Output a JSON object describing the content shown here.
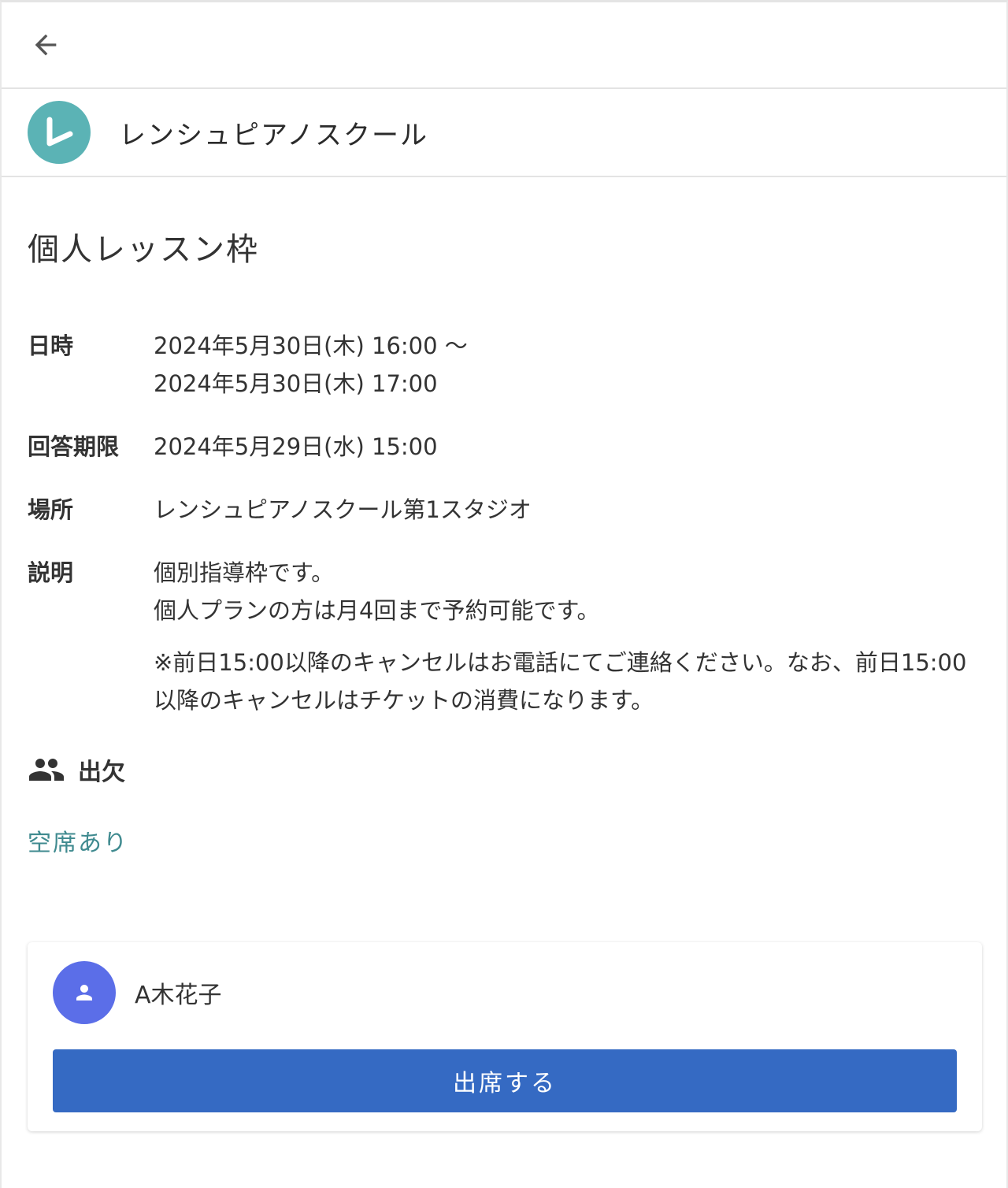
{
  "topbar": {
    "back_icon": "arrow-left-icon"
  },
  "organization": {
    "logo_letter": "L",
    "logo_color": "#5bb3b5",
    "name": "レンシュピアノスクール"
  },
  "event": {
    "title": "個人レッスン枠",
    "details": {
      "datetime": {
        "label": "日時",
        "start": "2024年5月30日(木) 16:00 〜",
        "end": "2024年5月30日(木) 17:00"
      },
      "deadline": {
        "label": "回答期限",
        "value": "2024年5月29日(水) 15:00"
      },
      "place": {
        "label": "場所",
        "value": "レンシュピアノスクール第1スタジオ"
      },
      "description": {
        "label": "説明",
        "line1": "個別指導枠です。",
        "line2": "個人プランの方は月4回まで予約可能です。",
        "note": "※前日15:00以降のキャンセルはお電話にてご連絡ください。なお、前日15:00以降のキャンセルはチケットの消費になります。"
      }
    }
  },
  "attendance": {
    "icon": "people-icon",
    "title": "出欠",
    "status": "空席あり",
    "status_color": "#3f8a8f"
  },
  "member": {
    "avatar_icon": "person-icon",
    "avatar_color": "#5b6ee8",
    "name": "A木花子",
    "attend_button_label": "出席する",
    "button_color": "#356ac3"
  }
}
